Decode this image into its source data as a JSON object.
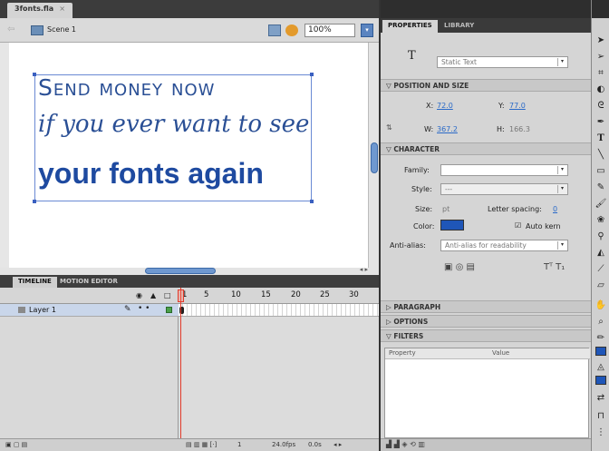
{
  "document": {
    "tab_label": "3fonts.fla",
    "close_glyph": "×"
  },
  "edit_bar": {
    "scene_label": "Scene 1",
    "zoom": "100%"
  },
  "stage": {
    "line1": "Send money now",
    "line2": "if you ever want to see",
    "line3": "your fonts again"
  },
  "timeline": {
    "tabs": [
      "TIMELINE",
      "MOTION EDITOR"
    ],
    "ruler": [
      "1",
      "5",
      "10",
      "15",
      "20",
      "25",
      "30"
    ],
    "layer_name": "Layer 1",
    "footer_frame": "1",
    "footer_fps": "24.0fps",
    "footer_time": "0.0s"
  },
  "properties": {
    "tabs": [
      "PROPERTIES",
      "LIBRARY"
    ],
    "tool_glyph": "T",
    "text_type": "Static Text",
    "position_size": {
      "header": "POSITION AND SIZE",
      "x_label": "X:",
      "x": "72.0",
      "y_label": "Y:",
      "y": "77.0",
      "w_label": "W:",
      "w": "367.2",
      "h_label": "H:",
      "h": "166.3"
    },
    "character": {
      "header": "CHARACTER",
      "family_label": "Family:",
      "family": "",
      "style_label": "Style:",
      "style": "---",
      "size_label": "Size:",
      "size": "pt",
      "letter_spacing_label": "Letter spacing:",
      "letter_spacing": "0",
      "color_label": "Color:",
      "color": "#1f56b8",
      "auto_kern_label": "Auto kern",
      "antialias_label": "Anti-alias:",
      "antialias": "Anti-alias for readability"
    },
    "paragraph_header": "PARAGRAPH",
    "options_header": "OPTIONS",
    "filters_header": "FILTERS",
    "filters_cols": [
      "Property",
      "Value"
    ]
  }
}
